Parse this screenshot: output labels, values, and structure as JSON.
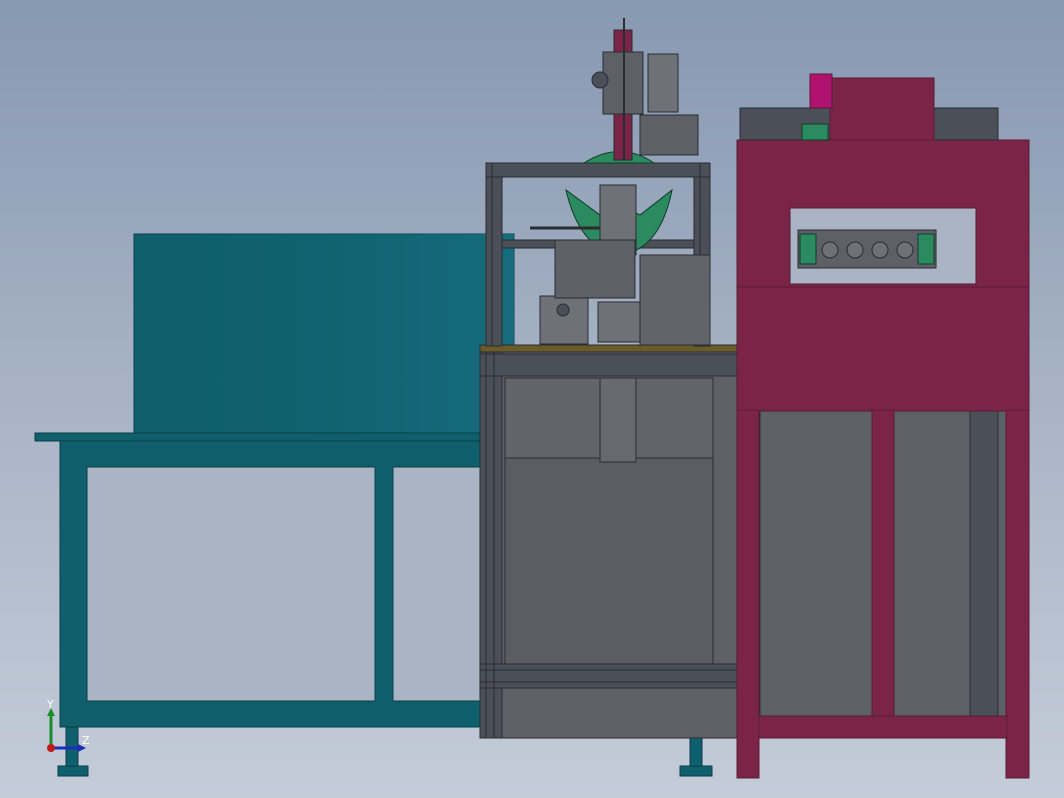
{
  "window": {
    "title": ""
  },
  "scene": {
    "description_items": [
      "workbench",
      "backboard-panel",
      "center-frame",
      "rotary-mechanism",
      "right-cabinet"
    ]
  },
  "triad": {
    "y_label": "Y",
    "z_label": "Z"
  },
  "colors": {
    "background_top": "#8798b1",
    "background_bottom": "#c4ccd8",
    "teal": "#0f5f6c",
    "teal_dark": "#0a3f48",
    "frame_gray": "#4b4f57",
    "panel_gray": "#5e6068",
    "cabinet_maroon": "#7a2547",
    "cabinet_maroon_dark": "#5a1a34",
    "green_part": "#2b8a5f",
    "magenta_part": "#b0126f",
    "plate_brown": "#6a5b2a"
  }
}
